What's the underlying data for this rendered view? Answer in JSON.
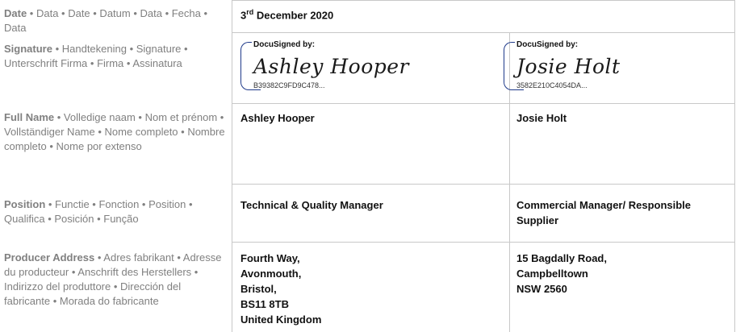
{
  "labels": {
    "date": {
      "bold": "Date",
      "rest": " • Data • Date • Datum • Data • Fecha • Data"
    },
    "signature": {
      "bold": "Signature",
      "rest": " • Handtekening • Signature • Unterschrift Firma • Firma • Assinatura"
    },
    "full_name": {
      "bold": "Full Name",
      "rest": " • Volledige naam • Nom et prénom • Vollständiger Name • Nome completo • Nombre completo • Nome por extenso"
    },
    "position": {
      "bold": "Position",
      "rest": " • Functie • Fonction • Position • Qualifica • Posición • Função"
    },
    "producer_address": {
      "bold": "Producer Address",
      "rest": " • Adres fabrikant • Adresse du producteur • Anschrift des Herstellers • Indirizzo del produttore • Dirección del fabricante • Morada do fabricante"
    }
  },
  "date": {
    "day": "3",
    "suffix": "rd",
    "rest": " December 2020"
  },
  "signers": [
    {
      "docusigned_label": "DocuSigned by:",
      "signature_text": "Ashley Hooper",
      "envelope_code": "B39382C9FD9C478...",
      "full_name": "Ashley Hooper",
      "position": "Technical & Quality Manager",
      "address_lines": [
        "Fourth Way,",
        "Avonmouth,",
        "Bristol,",
        "BS11 8TB",
        "United Kingdom"
      ]
    },
    {
      "docusigned_label": "DocuSigned by:",
      "signature_text": "Josie Holt",
      "envelope_code": "3582E210C4054DA...",
      "full_name": "Josie Holt",
      "position": "Commercial Manager/ Responsible Supplier",
      "address_lines": [
        "15 Bagdally Road,",
        "Campbelltown",
        "NSW 2560"
      ]
    }
  ]
}
